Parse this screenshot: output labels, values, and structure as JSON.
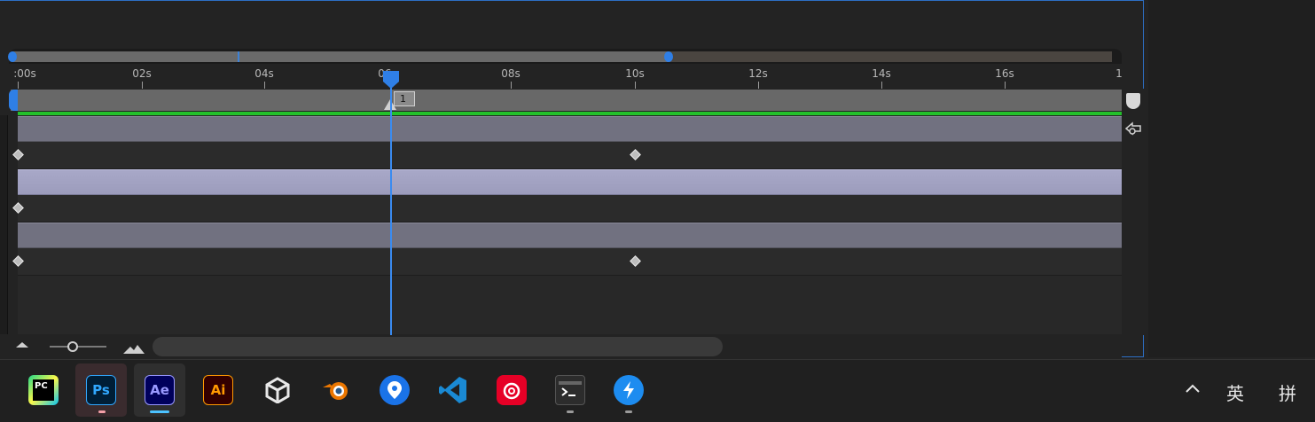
{
  "timeline": {
    "ruler_labels": [
      ":00s",
      "02s",
      "04s",
      "06s",
      "08s",
      "10s",
      "12s",
      "14s",
      "16s",
      "1"
    ],
    "marker_label": "1",
    "accent_color": "#2f7fe6",
    "green_bar_color": "#22c02a"
  },
  "taskbar": {
    "apps": [
      {
        "name": "pycharm",
        "label": "PC",
        "icon": "pycharm-icon"
      },
      {
        "name": "photoshop",
        "label": "Ps",
        "icon": "photoshop-icon"
      },
      {
        "name": "after-effects",
        "label": "Ae",
        "icon": "after-effects-icon"
      },
      {
        "name": "illustrator",
        "label": "Ai",
        "icon": "illustrator-icon"
      },
      {
        "name": "unity",
        "label": "",
        "icon": "unity-icon"
      },
      {
        "name": "blender",
        "label": "",
        "icon": "blender-icon"
      },
      {
        "name": "maps",
        "label": "",
        "icon": "map-pin-icon"
      },
      {
        "name": "vscode",
        "label": "",
        "icon": "vscode-icon"
      },
      {
        "name": "netease-music",
        "label": "",
        "icon": "music-icon"
      },
      {
        "name": "terminal",
        "label": "",
        "icon": "terminal-icon"
      },
      {
        "name": "thunder",
        "label": "",
        "icon": "lightning-icon"
      }
    ],
    "tray": {
      "chevron": "^",
      "lang_primary": "英",
      "lang_secondary": "拼"
    }
  }
}
